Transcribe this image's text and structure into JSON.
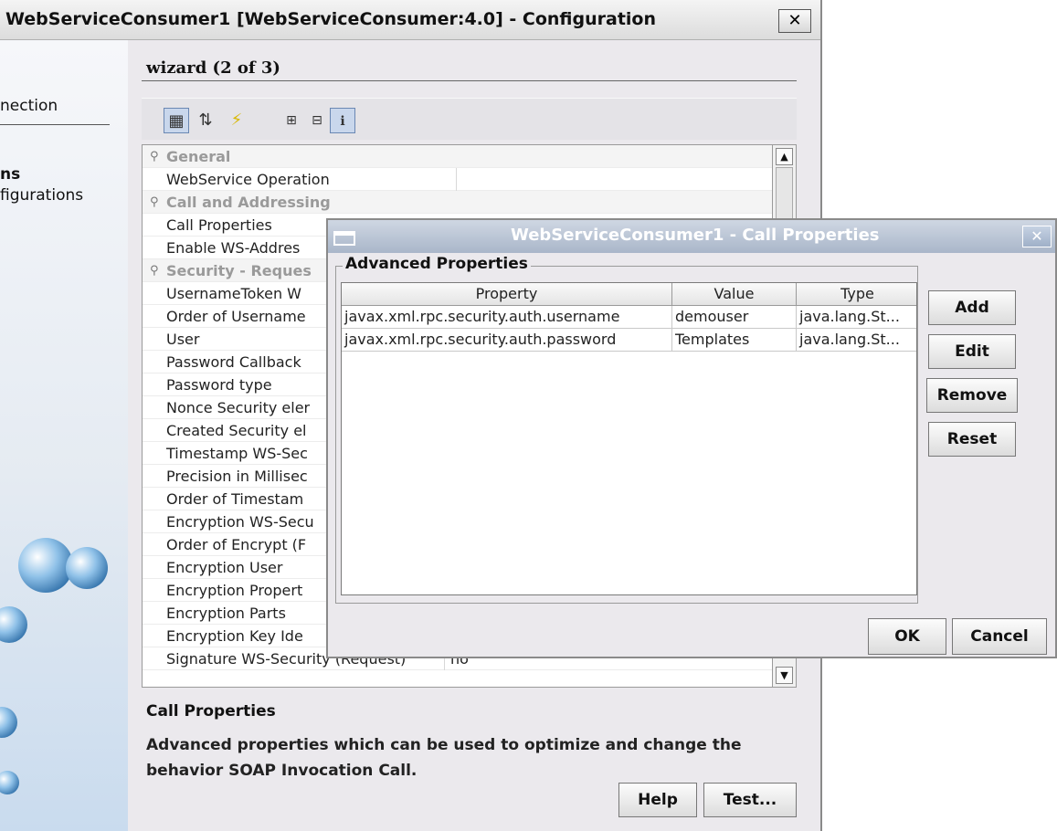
{
  "main_window": {
    "title": "WebServiceConsumer1 [WebServiceConsumer:4.0] - Configuration",
    "close_glyph": "✕"
  },
  "left_panel": {
    "items": [
      "nection",
      "ns",
      "figurations"
    ]
  },
  "wizard": {
    "step_label": "wizard (2 of 3)"
  },
  "toolbar": {
    "icons": [
      "categorized-view-icon",
      "sort-alphabetical-icon",
      "lightning-icon",
      "expand-icon",
      "collapse-icon",
      "info-icon"
    ]
  },
  "properties": {
    "rows": [
      {
        "label": "General",
        "type": "category"
      },
      {
        "label": "WebService Operation",
        "type": "prop"
      },
      {
        "label": "Call and Addressing",
        "type": "category"
      },
      {
        "label": "Call Properties",
        "type": "prop"
      },
      {
        "label": "Enable WS-Addres",
        "type": "prop"
      },
      {
        "label": "Security - Reques",
        "type": "category"
      },
      {
        "label": "UsernameToken W",
        "type": "prop"
      },
      {
        "label": "Order of Username",
        "type": "prop"
      },
      {
        "label": "User",
        "type": "prop"
      },
      {
        "label": "Password Callback",
        "type": "prop"
      },
      {
        "label": "Password type",
        "type": "prop"
      },
      {
        "label": "Nonce Security eler",
        "type": "prop"
      },
      {
        "label": "Created Security el",
        "type": "prop"
      },
      {
        "label": "Timestamp WS-Sec",
        "type": "prop"
      },
      {
        "label": "Precision in Millisec",
        "type": "prop"
      },
      {
        "label": "Order of Timestam",
        "type": "prop"
      },
      {
        "label": "Encryption WS-Secu",
        "type": "prop"
      },
      {
        "label": "Order of Encrypt (F",
        "type": "prop"
      },
      {
        "label": "Encryption User",
        "type": "prop"
      },
      {
        "label": "Encryption Propert",
        "type": "prop"
      },
      {
        "label": "Encryption Parts",
        "type": "prop"
      },
      {
        "label": "Encryption Key Ide",
        "type": "prop"
      },
      {
        "label": "Signature WS-Security (Request)",
        "type": "prop",
        "value": "no"
      }
    ]
  },
  "description": {
    "title": "Call Properties",
    "text": "Advanced properties which can be used to optimize and change the behavior SOAP Invocation Call."
  },
  "footer_buttons": {
    "help": "Help",
    "test": "Test..."
  },
  "dialog": {
    "title": "WebServiceConsumer1 - Call Properties",
    "close_glyph": "✕",
    "group_label": "Advanced Properties",
    "columns": [
      "Property",
      "Value",
      "Type"
    ],
    "rows": [
      [
        "javax.xml.rpc.security.auth.username",
        "demouser",
        "java.lang.St..."
      ],
      [
        "javax.xml.rpc.security.auth.password",
        "Templates",
        "java.lang.St..."
      ]
    ],
    "buttons": {
      "add": "Add",
      "edit": "Edit",
      "remove": "Remove",
      "reset": "Reset",
      "ok": "OK",
      "cancel": "Cancel"
    }
  }
}
